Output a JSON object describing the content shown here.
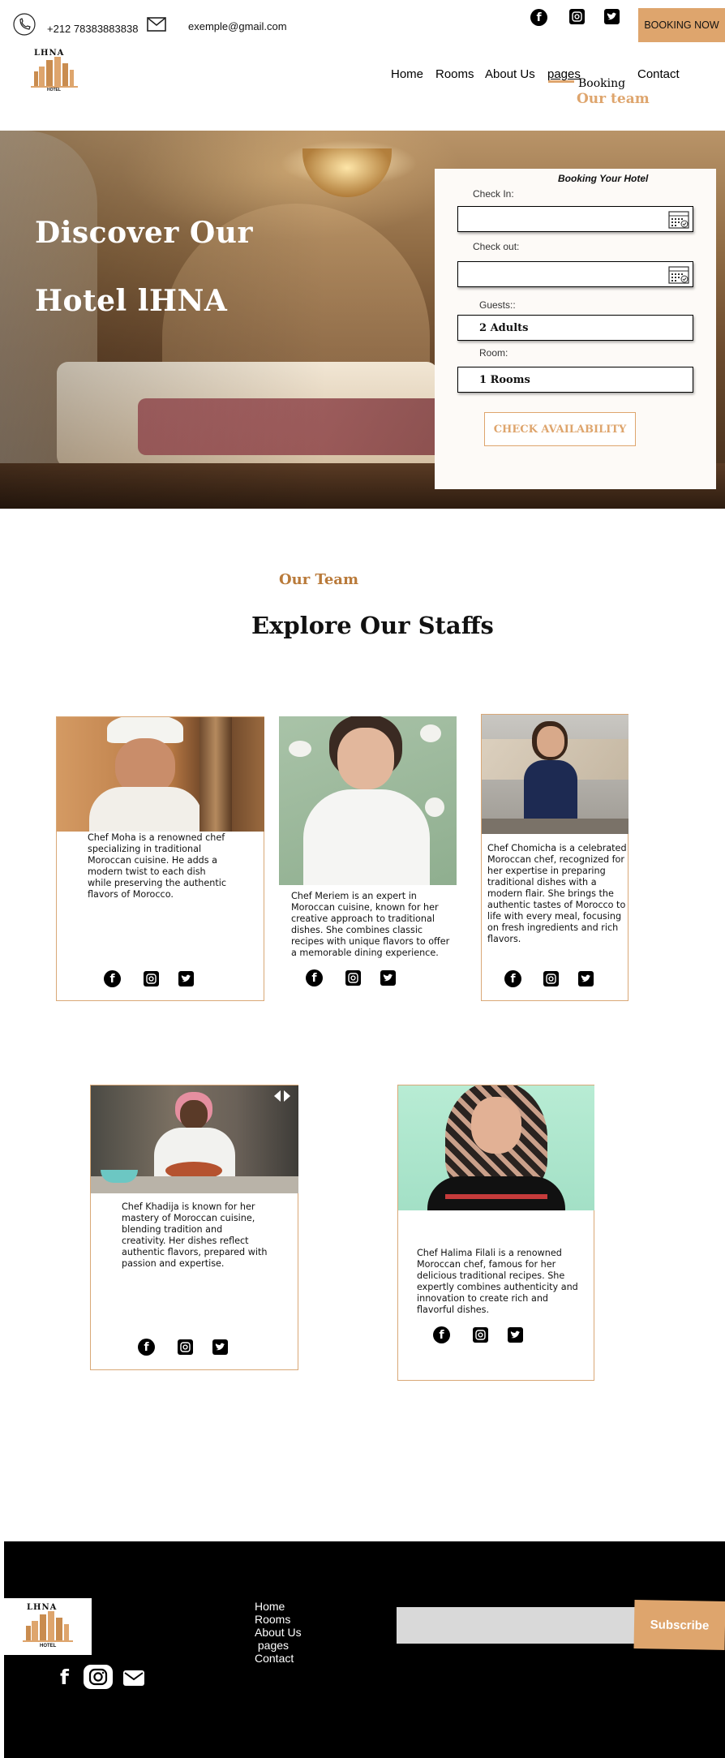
{
  "topbar": {
    "phone": "+212 78383883838",
    "email": "exemple@gmail.com",
    "booking_now": "BOOKING NOW",
    "icons": [
      "phone-icon",
      "mail-icon",
      "facebook-icon",
      "instagram-icon",
      "twitter-icon"
    ]
  },
  "logo": {
    "title": "LHNA",
    "subtitle": "HOTEL"
  },
  "nav": {
    "home": "Home",
    "rooms": "Rooms",
    "about": "About Us",
    "pages": "pages",
    "contact": "Contact",
    "dropdown": {
      "booking": "Booking",
      "our_team": "Our team"
    }
  },
  "hero": {
    "line1": "Discover Our",
    "line2": "Hotel lHNA"
  },
  "booking_form": {
    "title": "Booking Your Hotel",
    "check_in_label": "Check In:",
    "check_in_value": "",
    "check_out_label": "Check out:",
    "check_out_value": "",
    "guests_label": "Guests::",
    "guests_value": "2 Adults",
    "room_label": "Room:",
    "room_value": "1 Rooms",
    "submit": "CHECK AVAILABILITY"
  },
  "team": {
    "eyebrow": "Our Team",
    "heading": "Explore Our Staffs",
    "cards": [
      {
        "name": "Chef Moha",
        "text": "Chef Moha is a renowned chef specializing in traditional Moroccan cuisine. He adds a modern twist to each dish while preserving the authentic flavors of Morocco."
      },
      {
        "name": "Chef Meriem",
        "text": "Chef Meriem is an expert in Moroccan cuisine, known for her creative approach to traditional dishes. She combines classic recipes with unique flavors to offer a memorable dining experience."
      },
      {
        "name": "Chef Chomicha",
        "text": "Chef Chomicha is a celebrated Moroccan chef, recognized for her expertise in preparing traditional dishes with a modern flair. She brings the authentic tastes of Morocco to life with every meal, focusing on fresh ingredients and rich flavors."
      },
      {
        "name": "Chef Khadija",
        "text": "Chef Khadija is known for her mastery of Moroccan cuisine, blending tradition and creativity. Her dishes reflect authentic flavors, prepared with passion and expertise."
      },
      {
        "name": "Chef Halima Filali",
        "text": "Chef Halima Filali is a renowned Moroccan chef, famous for her delicious traditional recipes. She expertly combines authenticity and innovation to create rich and flavorful dishes."
      }
    ]
  },
  "footer": {
    "links": [
      "Home",
      "Rooms",
      "About Us",
      " pages",
      "Contact"
    ],
    "email_placeholder": "",
    "subscribe": "Subscribe",
    "icons": [
      "facebook-icon",
      "instagram-icon",
      "mail-icon"
    ]
  },
  "colors": {
    "accent": "#dea56d",
    "accent_dark": "#b97a3a",
    "footer_bg": "#000000",
    "panel_bg": "#fdfaf7"
  }
}
